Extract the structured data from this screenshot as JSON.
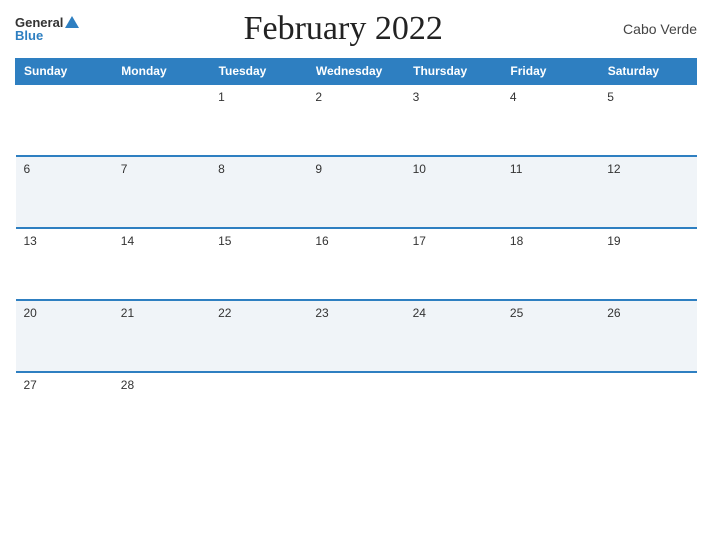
{
  "header": {
    "logo": {
      "general_text": "General",
      "blue_text": "Blue"
    },
    "title": "February 2022",
    "country": "Cabo Verde"
  },
  "days_of_week": [
    "Sunday",
    "Monday",
    "Tuesday",
    "Wednesday",
    "Thursday",
    "Friday",
    "Saturday"
  ],
  "weeks": [
    [
      null,
      null,
      1,
      2,
      3,
      4,
      5
    ],
    [
      6,
      7,
      8,
      9,
      10,
      11,
      12
    ],
    [
      13,
      14,
      15,
      16,
      17,
      18,
      19
    ],
    [
      20,
      21,
      22,
      23,
      24,
      25,
      26
    ],
    [
      27,
      28,
      null,
      null,
      null,
      null,
      null
    ]
  ]
}
